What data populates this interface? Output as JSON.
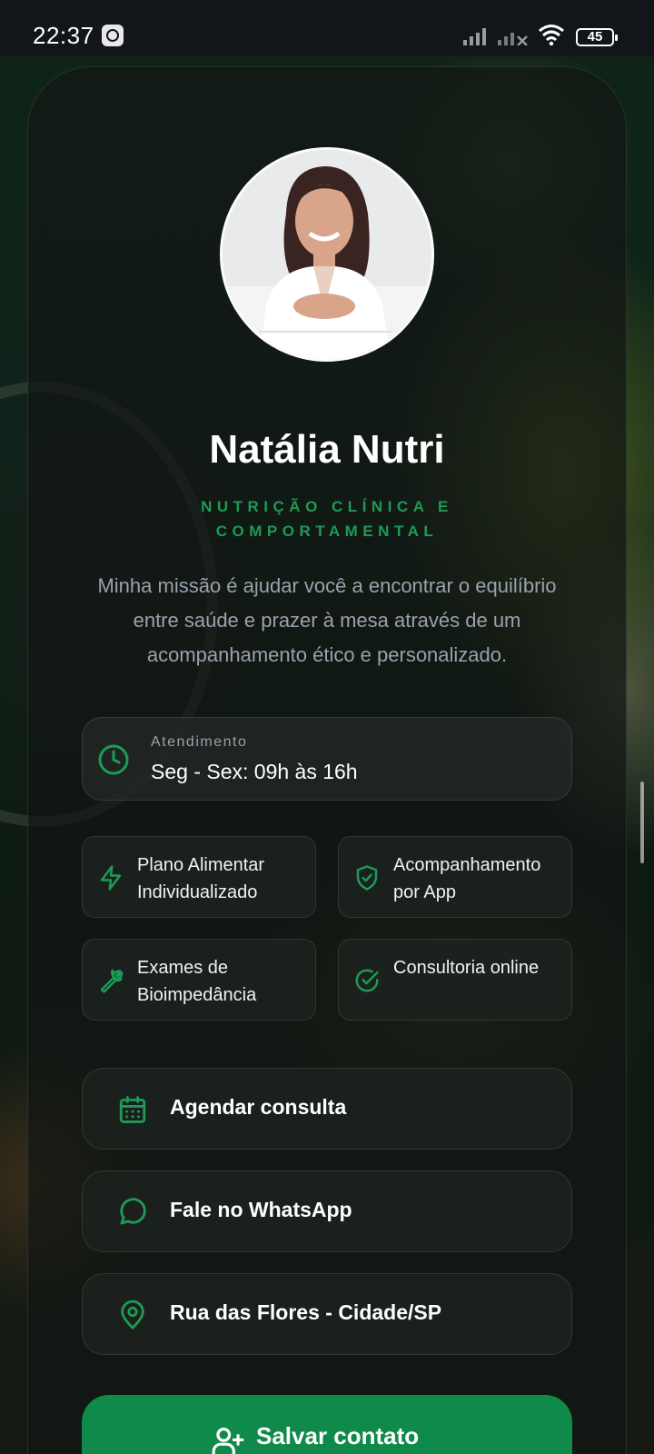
{
  "status_bar": {
    "time": "22:37",
    "battery": "45"
  },
  "profile": {
    "name": "Natália Nutri",
    "specialty": "NUTRIÇÃO CLÍNICA E COMPORTAMENTAL",
    "bio": "Minha missão é ajudar você a encontrar o equilíbrio entre saúde e prazer à mesa através de um acompanhamento ético e personalizado."
  },
  "hours": {
    "label": "Atendimento",
    "value": "Seg - Sex: 09h às 16h",
    "icon": "clock-icon"
  },
  "features": [
    {
      "label": "Plano Alimentar Individualizado",
      "icon": "lightning-icon"
    },
    {
      "label": "Acompanhamento por App",
      "icon": "shield-check-icon"
    },
    {
      "label": "Exames de Bioimpedância",
      "icon": "wrench-icon"
    },
    {
      "label": "Consultoria online",
      "icon": "check-circle-icon"
    }
  ],
  "actions": [
    {
      "label": "Agendar consulta",
      "icon": "calendar-icon"
    },
    {
      "label": "Fale no WhatsApp",
      "icon": "chat-bubble-icon"
    },
    {
      "label": "Rua das Flores - Cidade/SP",
      "icon": "location-pin-icon"
    }
  ],
  "save_button": {
    "label": "Salvar contato",
    "icon": "add-user-icon"
  },
  "colors": {
    "accent": "#1e9a56",
    "button": "#0f8a4a",
    "card_bg": "#121613",
    "text_muted": "#9aa1ad"
  }
}
